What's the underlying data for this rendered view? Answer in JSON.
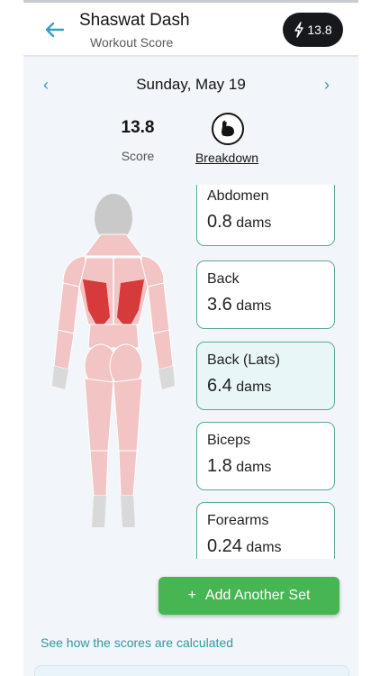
{
  "header": {
    "title": "Shaswat Dash",
    "subtitle": "Workout Score",
    "score_badge": "13.8",
    "back_icon": "arrow-left-icon",
    "badge_icon": "lightning-icon"
  },
  "date_nav": {
    "prev_icon": "chevron-left-icon",
    "date": "Sunday, May 19",
    "next_icon": "chevron-right-icon"
  },
  "summary": {
    "score_value": "13.8",
    "score_label": "Score",
    "breakdown_label": "Breakdown",
    "breakdown_icon": "flexed-arm-icon"
  },
  "muscle_cards": [
    {
      "name": "Abdomen",
      "value": "0.8",
      "unit": "dams",
      "selected": false
    },
    {
      "name": "Back",
      "value": "3.6",
      "unit": "dams",
      "selected": false
    },
    {
      "name": "Back (Lats)",
      "value": "6.4",
      "unit": "dams",
      "selected": true
    },
    {
      "name": "Biceps",
      "value": "1.8",
      "unit": "dams",
      "selected": false
    },
    {
      "name": "Forearms",
      "value": "0.24",
      "unit": "dams",
      "selected": false
    }
  ],
  "actions": {
    "add_set_label": "Add Another Set",
    "add_icon": "plus-icon",
    "calc_link": "See how the scores are calculated"
  },
  "colors": {
    "accent_teal": "#3b9dbb",
    "card_border": "#5aa99b",
    "selected_card_bg": "#e8f6f8",
    "add_button": "#47b552",
    "muscle_light": "#f2c4c4",
    "muscle_highlight": "#d63a3a",
    "badge_bg": "#16181c"
  }
}
